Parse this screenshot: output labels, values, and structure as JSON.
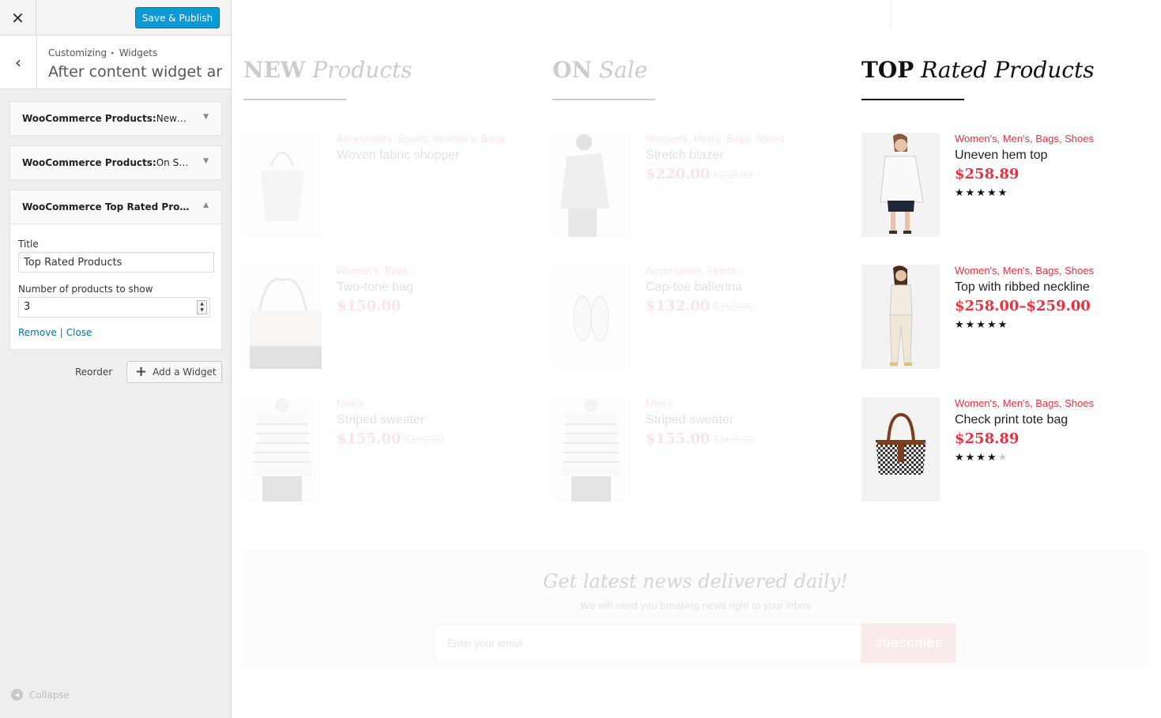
{
  "customizer": {
    "close_icon": "✕",
    "publish_label": "Save & Publish",
    "back_icon": "‹",
    "breadcrumb": [
      "Customizing",
      "Widgets"
    ],
    "breadcrumb_sep": "▸",
    "section_title": "After content widget ar…",
    "widgets": [
      {
        "title": "WooCommerce Products:",
        "subtitle": " New…",
        "arrow": "▼",
        "expanded": false
      },
      {
        "title": "WooCommerce Products:",
        "subtitle": " On S…",
        "arrow": "▼",
        "expanded": false
      },
      {
        "title": "WooCommerce Top Rated Pro…",
        "subtitle": "",
        "arrow": "▲",
        "expanded": true
      }
    ],
    "form": {
      "title_label": "Title",
      "title_value": "Top Rated Products",
      "count_label": "Number of products to show",
      "count_value": "3",
      "spin_up": "▲",
      "spin_down": "▼",
      "remove_label": "Remove",
      "link_sep": "|",
      "close_label": "Close"
    },
    "reorder_label": "Reorder",
    "add_widget_icon": "+",
    "add_widget_label": "Add a Widget",
    "collapse_icon": "◀",
    "collapse_label": "Collapse"
  },
  "preview": {
    "columns": [
      {
        "title_bold": "NEW",
        "title_italic": "Products",
        "active": false,
        "products": [
          {
            "cats": "Accessories, Sports, Women's, Bags",
            "name": "Woven fabric shopper",
            "price": "",
            "old_price": "",
            "stars": 0,
            "image": "tote-bag"
          },
          {
            "cats": "Women's, Bags",
            "name": "Two-tone bag",
            "price": "$150.00",
            "old_price": "",
            "stars": 0,
            "image": "handbag"
          },
          {
            "cats": "Men's",
            "name": "Striped sweater",
            "price": "$155.00",
            "old_price": "$160.00",
            "stars": 0,
            "image": "sweater"
          }
        ]
      },
      {
        "title_bold": "ON",
        "title_italic": "Sale",
        "active": false,
        "products": [
          {
            "cats": "Women's, Men's, Bags, Shoes",
            "name": "Stretch blazer",
            "price": "$220.00",
            "old_price": "$258.89",
            "stars": 0,
            "image": "blazer"
          },
          {
            "cats": "Accessories, Sports",
            "name": "Cap-toe ballerina",
            "price": "$132.00",
            "old_price": "$152.00",
            "stars": 0,
            "image": "shoes"
          },
          {
            "cats": "Men's",
            "name": "Striped sweater",
            "price": "$155.00",
            "old_price": "$160.00",
            "stars": 0,
            "image": "sweater"
          }
        ]
      },
      {
        "title_bold": "TOP",
        "title_italic": "Rated Products",
        "active": true,
        "products": [
          {
            "cats": "Women's, Men's, Bags, Shoes",
            "name": "Uneven hem top",
            "price": "$258.89",
            "old_price": "",
            "stars": 5,
            "image": "woman-top"
          },
          {
            "cats": "Women's, Men's, Bags, Shoes",
            "name": "Top with ribbed neckline",
            "price": "$258.00–$259.00",
            "old_price": "",
            "stars": 5,
            "image": "woman-white"
          },
          {
            "cats": "Women's, Men's, Bags, Shoes",
            "name": "Check print tote bag",
            "price": "$258.89",
            "old_price": "",
            "stars": 4,
            "image": "check-bag"
          }
        ]
      }
    ],
    "newsletter": {
      "title": "Get latest news delivered daily!",
      "subtitle": "We will send you breaking news right to your inbox",
      "email_placeholder": "Enter your email",
      "button_label": "SUBSCRIBE"
    }
  },
  "colors": {
    "accent": "#e8313f",
    "primary_button": "#0a9ad6",
    "link": "#0073aa"
  }
}
